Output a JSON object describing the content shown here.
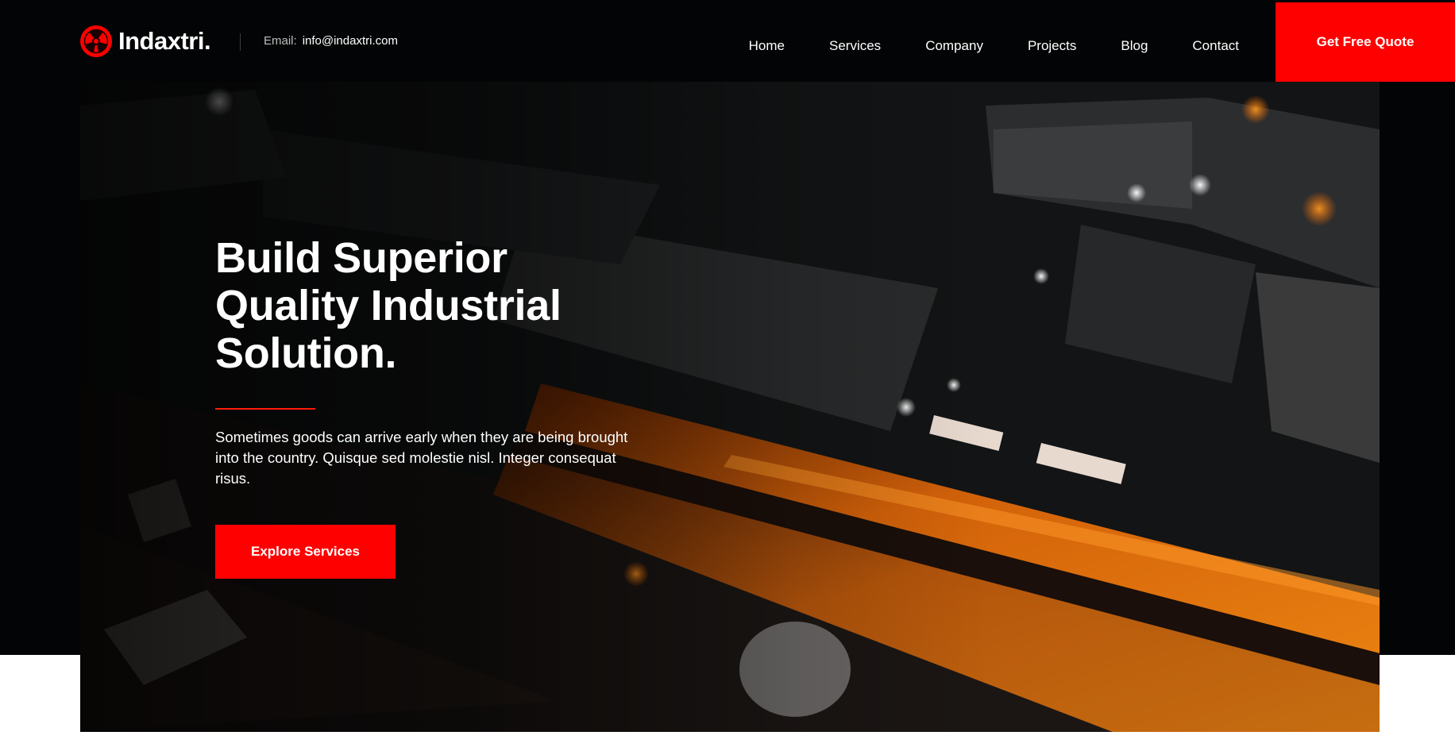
{
  "brand": {
    "name": "Indaxtri.",
    "logo_icon": "radiation-hazard-icon",
    "accent_color": "#ff0000"
  },
  "header": {
    "email_label": "Email:",
    "email_value": "info@indaxtri.com",
    "nav": [
      {
        "label": "Home"
      },
      {
        "label": "Services"
      },
      {
        "label": "Company"
      },
      {
        "label": "Projects"
      },
      {
        "label": "Blog"
      },
      {
        "label": "Contact"
      }
    ],
    "cta_label": "Get Free Quote"
  },
  "hero": {
    "background": "aerial-night-industrial-highway-image",
    "title_lines": [
      "Build Superior",
      "Quality Industrial",
      "Solution."
    ],
    "subtitle": "Sometimes goods can arrive early when they are being brought into the country. Quisque sed molestie nisl. Integer consequat risus.",
    "button_label": "Explore Services"
  }
}
